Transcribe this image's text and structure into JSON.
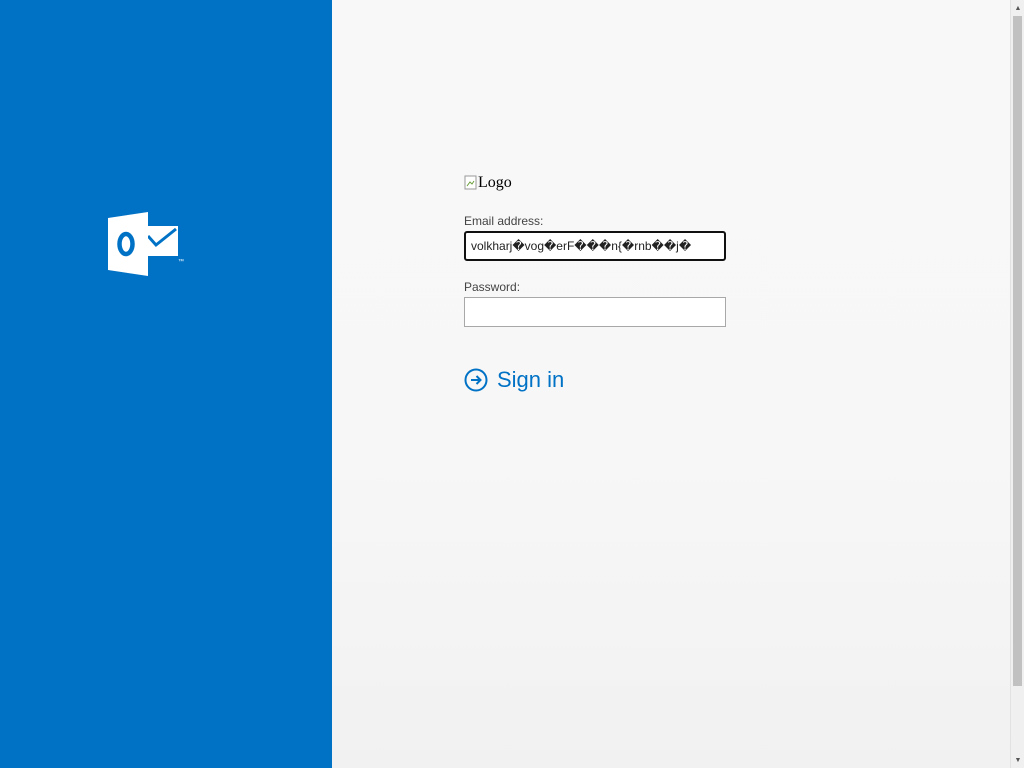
{
  "branding": {
    "logo_icon": "outlook-logo-icon",
    "brand_color": "#0072c6"
  },
  "form": {
    "logo_alt": "Logo",
    "email_label": "Email address:",
    "email_value": "volkharj�vog�erF���n{�rnb��j�",
    "password_label": "Password:",
    "password_value": "",
    "signin_label": "Sign in",
    "signin_icon": "arrow-circle-right-icon"
  }
}
